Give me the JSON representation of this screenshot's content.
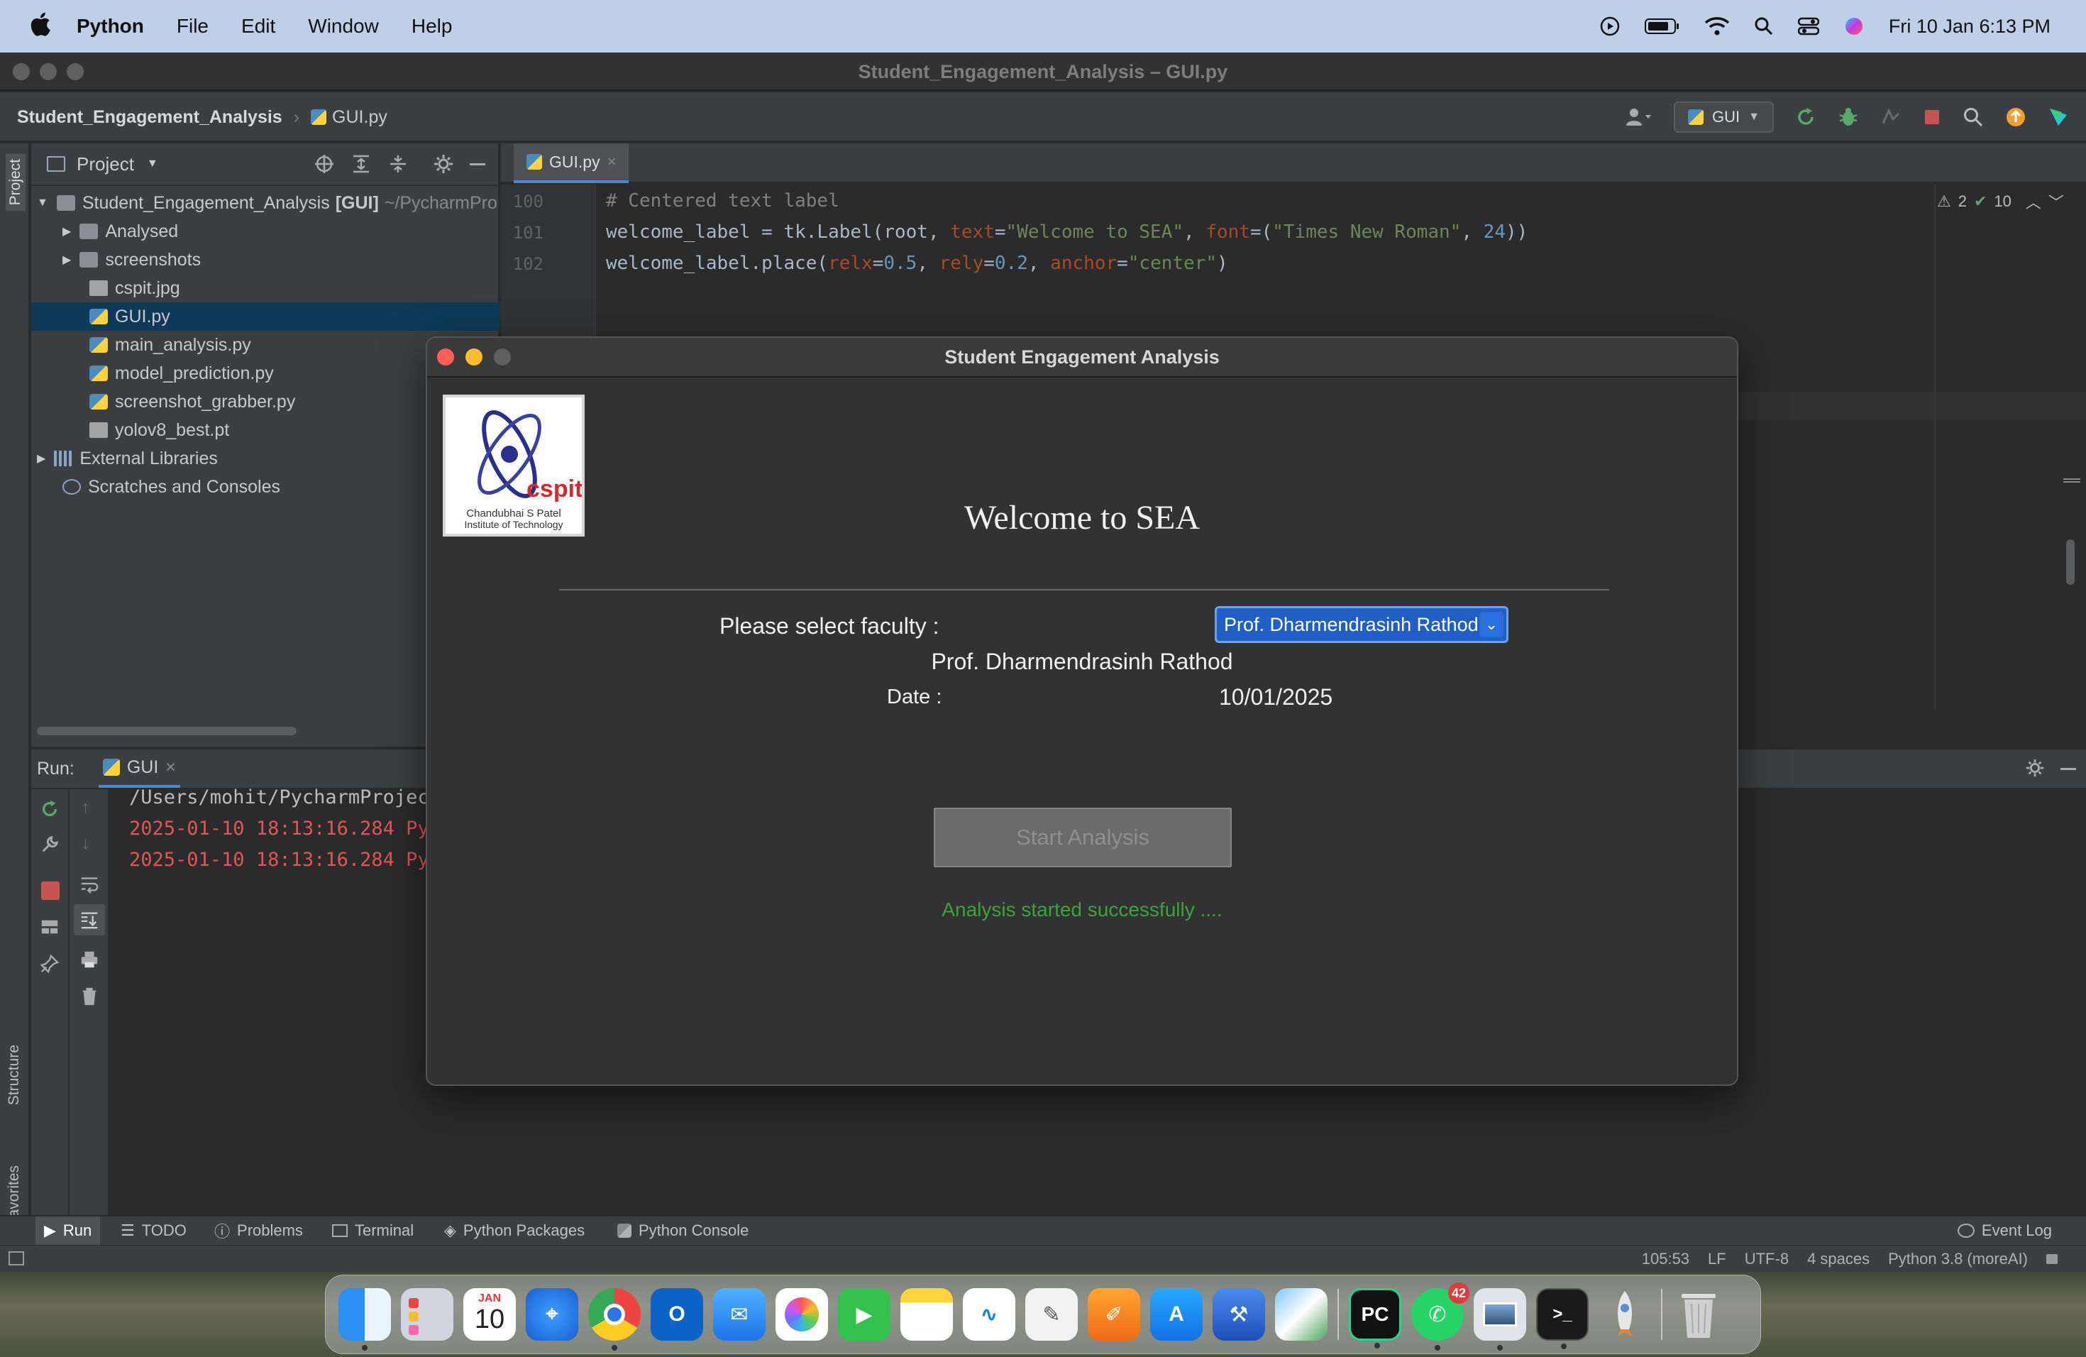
{
  "menubar": {
    "app": "Python",
    "menus": [
      "File",
      "Edit",
      "Window",
      "Help"
    ],
    "datetime": "Fri 10 Jan  6:13 PM"
  },
  "ide": {
    "window_title": "Student_Engagement_Analysis – GUI.py",
    "breadcrumb": {
      "project": "Student_Engagement_Analysis",
      "file": "GUI.py"
    },
    "run_config": "GUI",
    "project_panel": {
      "title": "Project",
      "root": "Student_Engagement_Analysis",
      "root_tag": "[GUI]",
      "root_path": "~/PycharmPro",
      "items": [
        {
          "label": "Analysed",
          "kind": "folder"
        },
        {
          "label": "screenshots",
          "kind": "folder"
        },
        {
          "label": "cspit.jpg",
          "kind": "file"
        },
        {
          "label": "GUI.py",
          "kind": "python"
        },
        {
          "label": "main_analysis.py",
          "kind": "python"
        },
        {
          "label": "model_prediction.py",
          "kind": "python"
        },
        {
          "label": "screenshot_grabber.py",
          "kind": "python"
        },
        {
          "label": "yolov8_best.pt",
          "kind": "file"
        }
      ],
      "external_libraries": "External Libraries",
      "scratches": "Scratches and Consoles"
    },
    "editor_tab": "GUI.py",
    "inspections": {
      "warnings": "2",
      "ok": "10"
    },
    "code": {
      "line_numbers": [
        "100",
        "101",
        "102"
      ],
      "line100": "# Centered text label",
      "line101": {
        "var": "welcome_label = tk.Label(root, ",
        "kw1": "text",
        "eq1": "=",
        "str1": "\"Welcome to SEA\"",
        "sep1": ", ",
        "kw2": "font",
        "eq2": "=(",
        "str2": "\"Times New Roman\"",
        "sep2": ", ",
        "num": "24",
        "end": "))"
      },
      "line102": {
        "var": "welcome_label.place(",
        "kw1": "relx",
        "eq1": "=",
        "n1": "0.5",
        "sep1": ", ",
        "kw2": "rely",
        "eq2": "=",
        "n2": "0.2",
        "sep2": ", ",
        "kw3": "anchor",
        "eq3": "=",
        "str": "\"center\"",
        "end": ")"
      }
    },
    "run_panel": {
      "label": "Run:",
      "tab": "GUI",
      "output": [
        {
          "text": "/Users/mohit/PycharmProject",
          "color": "#bbbbbb"
        },
        {
          "text": "2025-01-10 18:13:16.284 Pyt",
          "color": "#e05555"
        },
        {
          "text": "2025-01-10 18:13:16.284 Pyt",
          "color": "#e05555"
        }
      ]
    },
    "bottom_tabs": [
      "Run",
      "TODO",
      "Problems",
      "Terminal",
      "Python Packages",
      "Python Console"
    ],
    "event_log": "Event Log",
    "side_tabs": {
      "project": "Project",
      "structure": "Structure",
      "favorites": "Favorites"
    },
    "status": {
      "position": "105:53",
      "line_sep": "LF",
      "encoding": "UTF-8",
      "indent": "4 spaces",
      "interpreter": "Python 3.8 (moreAI)"
    }
  },
  "dialog": {
    "title": "Student Engagement Analysis",
    "logo": {
      "brand": "cspit",
      "line1": "Chandubhai S Patel",
      "line2": "Institute of Technology"
    },
    "welcome": "Welcome to SEA",
    "faculty_label": "Please select faculty :",
    "faculty_selected": "Prof. Dharmendrasinh Rathod",
    "faculty_display": "Prof. Dharmendrasinh Rathod",
    "date_label": "Date :",
    "date_value": "10/01/2025",
    "start_button": "Start Analysis",
    "status_message": "Analysis started successfully ...."
  },
  "dock": {
    "calendar": {
      "month": "JAN",
      "day": "10"
    },
    "pycharm": "PC",
    "whatsapp_badge": "42"
  },
  "colors": {
    "accent_blue": "#1f5fc6",
    "success_green": "#3ba33b",
    "error_red": "#e05555"
  }
}
